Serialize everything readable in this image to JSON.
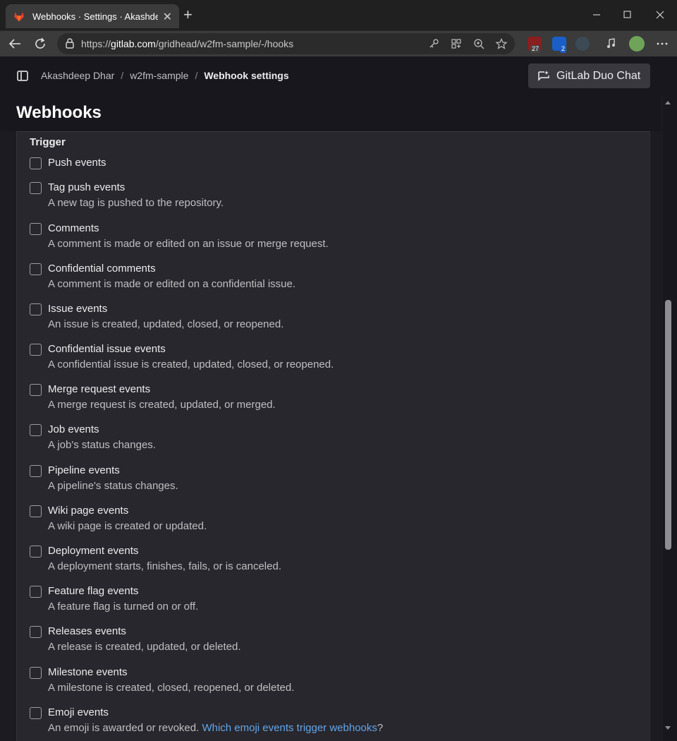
{
  "browser": {
    "tab_title": "Webhooks · Settings · Akashdeep",
    "close_glyph": "✕",
    "newtab_glyph": "+",
    "url_prefix": "https://",
    "url_host": "gitlab.com",
    "url_path": "/gridhead/w2fm-sample/-/hooks",
    "ext_badges": [
      "27",
      "2"
    ]
  },
  "header": {
    "breadcrumb": [
      "Akashdeep Dhar",
      "w2fm-sample",
      "Webhook settings"
    ],
    "breadcrumb_sep": "/",
    "duo_label": "GitLab Duo Chat"
  },
  "page": {
    "title": "Webhooks",
    "section_label": "Trigger"
  },
  "triggers": [
    {
      "label": "Push events",
      "help": ""
    },
    {
      "label": "Tag push events",
      "help": "A new tag is pushed to the repository."
    },
    {
      "label": "Comments",
      "help": "A comment is made or edited on an issue or merge request."
    },
    {
      "label": "Confidential comments",
      "help": "A comment is made or edited on a confidential issue."
    },
    {
      "label": "Issue events",
      "help": "An issue is created, updated, closed, or reopened."
    },
    {
      "label": "Confidential issue events",
      "help": "A confidential issue is created, updated, closed, or reopened."
    },
    {
      "label": "Merge request events",
      "help": "A merge request is created, updated, or merged."
    },
    {
      "label": "Job events",
      "help": "A job's status changes."
    },
    {
      "label": "Pipeline events",
      "help": "A pipeline's status changes."
    },
    {
      "label": "Wiki page events",
      "help": "A wiki page is created or updated."
    },
    {
      "label": "Deployment events",
      "help": "A deployment starts, finishes, fails, or is canceled."
    },
    {
      "label": "Feature flag events",
      "help": "A feature flag is turned on or off."
    },
    {
      "label": "Releases events",
      "help": "A release is created, updated, or deleted."
    },
    {
      "label": "Milestone events",
      "help": "A milestone is created, closed, reopened, or deleted."
    },
    {
      "label": "Emoji events",
      "help": "An emoji is awarded or revoked. ",
      "link": "Which emoji events trigger webhooks",
      "after": "?"
    }
  ],
  "colors": {
    "accent_link": "#63a6e9",
    "page_bg": "#1c1b21",
    "panel_bg": "#28272d"
  }
}
